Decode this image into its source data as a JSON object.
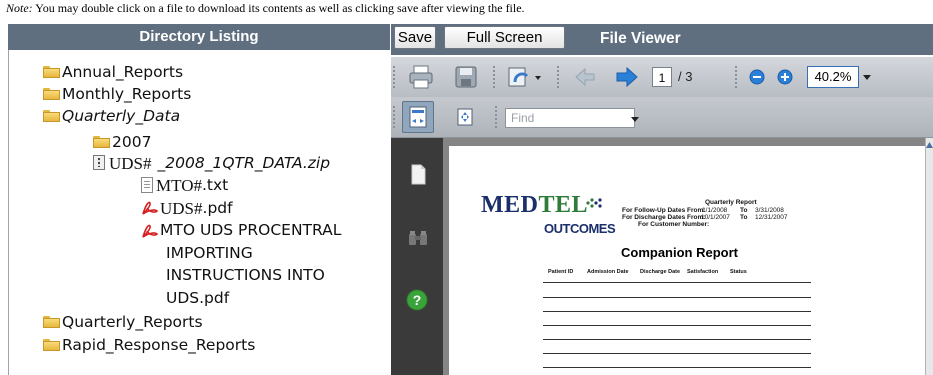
{
  "note": {
    "prefix": "Note:",
    "text": " You may double click on a file to download its contents as well as clicking save after viewing the file."
  },
  "directory": {
    "header": "Directory Listing",
    "items": [
      {
        "label": "Annual_Reports",
        "type": "folder"
      },
      {
        "label": "Monthly_Reports",
        "type": "folder"
      },
      {
        "label": "Quarterly_Data",
        "type": "folder"
      },
      {
        "label": "2007",
        "type": "folder"
      },
      {
        "label_a": "UDS#",
        "label_b": "_2008_1QTR_DATA.zip",
        "type": "zip"
      },
      {
        "label_a": "MTO#",
        "label_b": ".txt",
        "type": "txt"
      },
      {
        "label_a": "UDS#",
        "label_b": ".pdf",
        "type": "pdf"
      },
      {
        "lines": [
          "MTO UDS PROCENTRAL",
          "IMPORTING",
          "INSTRUCTIONS INTO",
          "UDS.pdf"
        ],
        "type": "pdf"
      },
      {
        "label": "Quarterly_Reports",
        "type": "folder"
      },
      {
        "label": "Rapid_Response_Reports",
        "type": "folder"
      }
    ]
  },
  "viewer": {
    "save_label": "Save",
    "fullscreen_label": "Full Screen",
    "title": "File Viewer",
    "toolbar": {
      "current_page": "1",
      "total_pages": "/ 3",
      "zoom": "40.2%",
      "find_placeholder": "Find"
    },
    "document": {
      "logo_med": "MED",
      "logo_tel": "TEL",
      "logo_outcomes": "OUTCOMES",
      "report_title": "Quarterly Report",
      "line1_label": "For Follow-Up Dates From:",
      "line1_from": "1/1/2008",
      "line1_to_word": "To",
      "line1_to": "3/31/2008",
      "line2_label": "For Discharge Dates From:",
      "line2_from": "10/1/2007",
      "line2_to_word": "To",
      "line2_to": "12/31/2007",
      "line3_label": "For Customer Number:",
      "heading": "Companion Report",
      "columns": [
        "Patient ID",
        "Admission Date",
        "Discharge Date",
        "Satisfaction",
        "Status"
      ]
    }
  },
  "colors": {
    "header_bar": "#5f6f80",
    "folder": "#f2c85b",
    "pdf_red": "#d42020",
    "help_green": "#3aa33a",
    "nav_blue": "#2a7fd6"
  }
}
